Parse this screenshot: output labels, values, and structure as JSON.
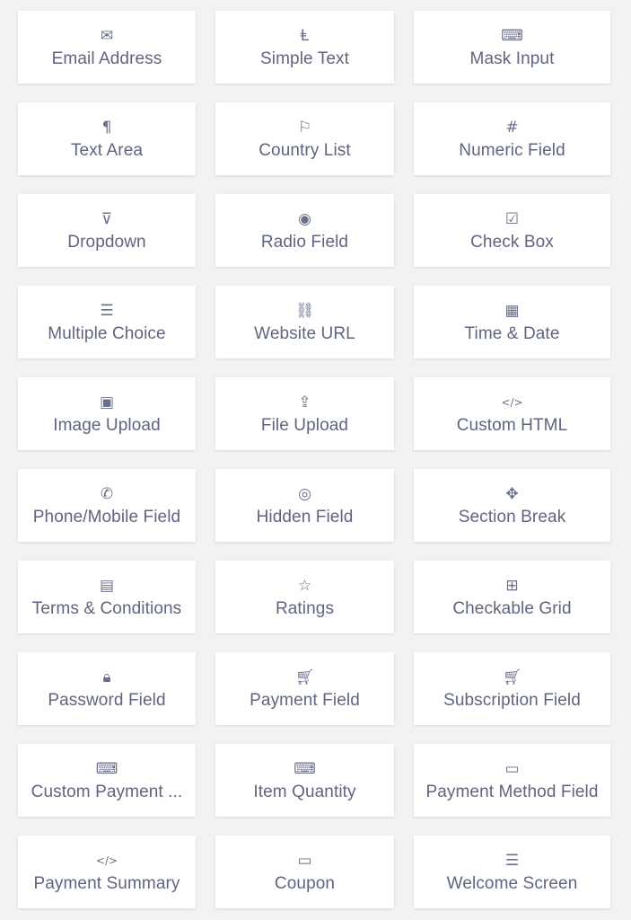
{
  "text_color": "#5f6581",
  "fields": [
    {
      "label": "Email Address",
      "icon": "envelope-icon",
      "glyph": "✉"
    },
    {
      "label": "Simple Text",
      "icon": "text-cursor-icon",
      "glyph": "Ⱡ"
    },
    {
      "label": "Mask Input",
      "icon": "keyboard-icon",
      "glyph": "⌨"
    },
    {
      "label": "Text Area",
      "icon": "paragraph-icon",
      "glyph": "¶"
    },
    {
      "label": "Country List",
      "icon": "flag-icon",
      "glyph": "⚐"
    },
    {
      "label": "Numeric Field",
      "icon": "hash-icon",
      "glyph": "#"
    },
    {
      "label": "Dropdown",
      "icon": "dropdown-icon",
      "glyph": "⊽"
    },
    {
      "label": "Radio Field",
      "icon": "radio-icon",
      "glyph": "◉"
    },
    {
      "label": "Check Box",
      "icon": "checkbox-icon",
      "glyph": "☑"
    },
    {
      "label": "Multiple Choice",
      "icon": "list-icon",
      "glyph": "☰"
    },
    {
      "label": "Website URL",
      "icon": "link-icon",
      "glyph": "⛓"
    },
    {
      "label": "Time & Date",
      "icon": "calendar-icon",
      "glyph": "▦"
    },
    {
      "label": "Image Upload",
      "icon": "image-icon",
      "glyph": "▣"
    },
    {
      "label": "File Upload",
      "icon": "upload-icon",
      "glyph": "⇪"
    },
    {
      "label": "Custom HTML",
      "icon": "code-icon",
      "glyph": "</>"
    },
    {
      "label": "Phone/Mobile Field",
      "icon": "phone-icon",
      "glyph": "✆"
    },
    {
      "label": "Hidden Field",
      "icon": "eye-slash-icon",
      "glyph": "◎"
    },
    {
      "label": "Section Break",
      "icon": "puzzle-icon",
      "glyph": "✥"
    },
    {
      "label": "Terms & Conditions",
      "icon": "document-icon",
      "glyph": "▤"
    },
    {
      "label": "Ratings",
      "icon": "star-icon",
      "glyph": "☆"
    },
    {
      "label": "Checkable Grid",
      "icon": "grid-check-icon",
      "glyph": "⊞"
    },
    {
      "label": "Password Field",
      "icon": "lock-icon",
      "glyph": "🔒︎"
    },
    {
      "label": "Payment Field",
      "icon": "cart-icon",
      "glyph": "🛒︎"
    },
    {
      "label": "Subscription Field",
      "icon": "cart-icon",
      "glyph": "🛒︎"
    },
    {
      "label": "Custom Payment ...",
      "icon": "keyboard-icon",
      "glyph": "⌨"
    },
    {
      "label": "Item Quantity",
      "icon": "keyboard-icon",
      "glyph": "⌨"
    },
    {
      "label": "Payment Method Field",
      "icon": "credit-card-icon",
      "glyph": "▭"
    },
    {
      "label": "Payment Summary",
      "icon": "code-icon",
      "glyph": "</>"
    },
    {
      "label": "Coupon",
      "icon": "coupon-icon",
      "glyph": "▭"
    },
    {
      "label": "Welcome Screen",
      "icon": "welcome-screen-icon",
      "glyph": "☰"
    }
  ]
}
